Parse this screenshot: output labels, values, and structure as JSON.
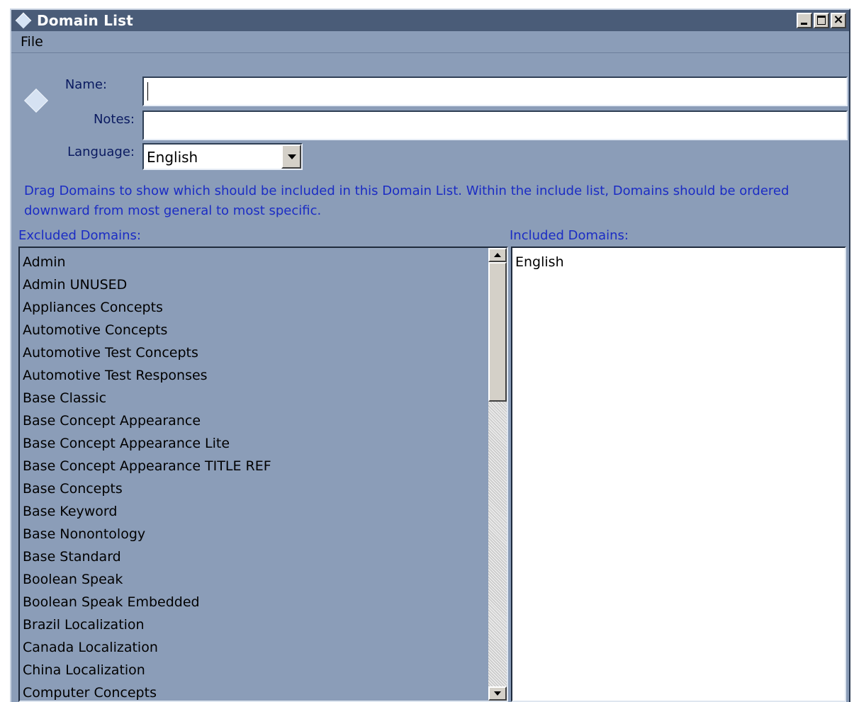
{
  "window": {
    "title": "Domain List"
  },
  "menu": {
    "file": "File"
  },
  "form": {
    "name_label": "Name:",
    "name_value": "",
    "notes_label": "Notes:",
    "notes_value": "",
    "language_label": "Language:",
    "language_value": "English"
  },
  "instructions": "Drag Domains to show which should be included in this Domain List. Within the include list, Domains should be ordered downward from most general to most specific.",
  "excluded": {
    "label": "Excluded Domains:",
    "items": [
      "Admin",
      "Admin UNUSED",
      "Appliances Concepts",
      "Automotive Concepts",
      "Automotive Test Concepts",
      "Automotive Test Responses",
      "Base Classic",
      "Base Concept Appearance",
      "Base Concept Appearance Lite",
      "Base Concept Appearance TITLE REF",
      "Base Concepts",
      "Base Keyword",
      "Base Nonontology",
      "Base Standard",
      "Boolean Speak",
      "Boolean Speak Embedded",
      "Brazil Localization",
      "Canada Localization",
      "China Localization",
      "Computer Concepts"
    ]
  },
  "included": {
    "label": "Included Domains:",
    "items": [
      "English"
    ]
  },
  "colors": {
    "window_bg": "#8b9db8",
    "titlebar": "#4a5c78",
    "label_blue": "#1b2cc4"
  }
}
